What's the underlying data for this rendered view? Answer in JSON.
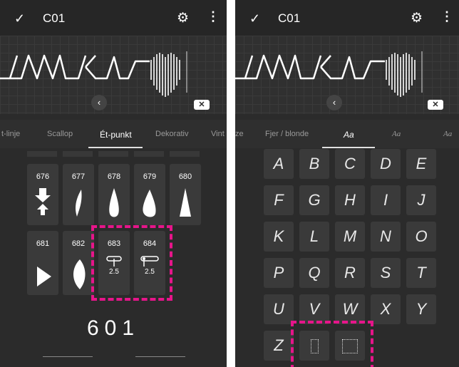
{
  "left": {
    "title": "C01",
    "tabs": [
      "t-linje",
      "Scallop",
      "Ét-punkt",
      "Dekorativ",
      "Vint"
    ],
    "active_tab": "Ét-punkt",
    "stitches_row1": [
      "676",
      "677",
      "678",
      "679",
      "680"
    ],
    "stitches_row2": [
      "681",
      "682",
      "683",
      "684"
    ],
    "stitch_683_value": "2.5",
    "stitch_684_value": "2.5",
    "current_number": "601",
    "icons": {
      "check": "check-icon",
      "settings": "gear-icon",
      "menu": "more-vertical-icon",
      "backspace": "backspace-icon",
      "collapse": "chevron-left-icon"
    }
  },
  "right": {
    "title": "C01",
    "tabs": [
      "ze",
      "Fjer / blonde",
      "Aa",
      "Aa",
      "Aa"
    ],
    "active_tab": "Aa",
    "letters": [
      "A",
      "B",
      "C",
      "D",
      "E",
      "F",
      "G",
      "H",
      "I",
      "J",
      "K",
      "L",
      "M",
      "N",
      "O",
      "P",
      "Q",
      "R",
      "S",
      "T",
      "U",
      "V",
      "W",
      "X",
      "Y",
      "Z"
    ]
  },
  "colors": {
    "highlight": "#e6158a",
    "background": "#2b2b2b"
  }
}
